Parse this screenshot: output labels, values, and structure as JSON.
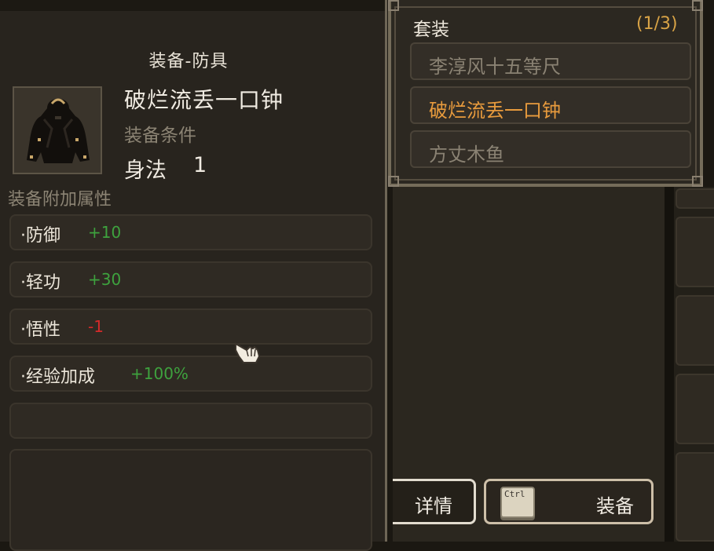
{
  "equipment": {
    "category_title": "装备-防具",
    "item_name": "破烂流丢一口钟",
    "requirement_label": "装备条件",
    "requirement_attr": "身法",
    "requirement_value": "1",
    "icon": "cloak-icon"
  },
  "bonus": {
    "label": "装备附加属性",
    "rows": [
      {
        "name": "·防御",
        "value": "+10",
        "color": "#3ea23e"
      },
      {
        "name": "·轻功",
        "value": "+30",
        "color": "#3ea23e"
      },
      {
        "name": "·悟性",
        "value": "-1",
        "color": "#d42a2a"
      },
      {
        "name": "·经验加成",
        "value": "+100%",
        "color": "#3ea23e"
      }
    ]
  },
  "set": {
    "title": "套装",
    "count": "(1/3)",
    "items": [
      {
        "name": "李淳风十五等尺",
        "active": false
      },
      {
        "name": "破烂流丢一口钟",
        "active": true
      },
      {
        "name": "方丈木鱼",
        "active": false
      }
    ]
  },
  "actions": {
    "detail_label": "详情",
    "equip_label": "装备",
    "hotkey": "Ctrl"
  },
  "colors": {
    "positive": "#3ea23e",
    "negative": "#d42a2a",
    "set_active": "#e89b3d"
  }
}
